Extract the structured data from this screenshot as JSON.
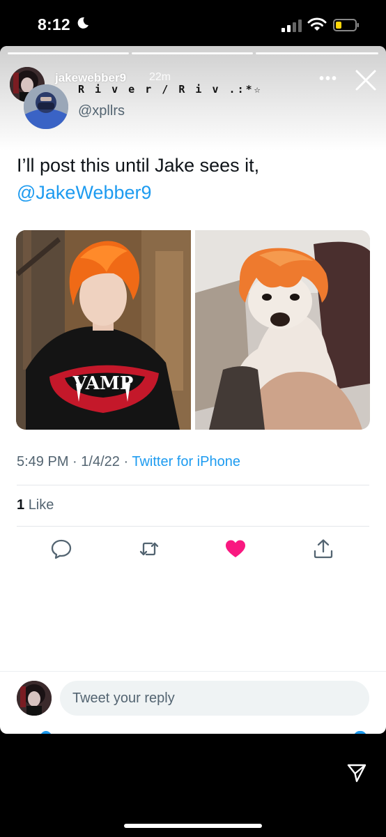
{
  "status_bar": {
    "time": "8:12"
  },
  "story": {
    "username": "jakewebber9",
    "age": "22m",
    "more": "•••",
    "segments": 3
  },
  "tweet": {
    "display_name": "R i v e r / R i v .:*☆",
    "handle": "@xpllrs",
    "text": "I’ll post this until Jake sees it,",
    "mention": "@JakeWebber9",
    "media_images": [
      {
        "description": "orange-haired man in VAMP sweater"
      },
      {
        "description": "chihuahua with orange peel on head"
      }
    ],
    "sweater_text": "VAMP",
    "time": "5:49 PM",
    "date": "1/4/22",
    "separator": "·",
    "source": "Twitter for iPhone",
    "like_count": "1",
    "like_label": "Like"
  },
  "actions": [
    {
      "name": "reply",
      "icon": "speech-bubble-icon"
    },
    {
      "name": "retweet",
      "icon": "retweet-icon"
    },
    {
      "name": "like",
      "icon": "heart-icon",
      "active": true
    },
    {
      "name": "share",
      "icon": "share-icon"
    }
  ],
  "reply_bar": {
    "placeholder": "Tweet your reply"
  },
  "colors": {
    "accent": "#1d9bf0",
    "like": "#f91880",
    "text": "#0f1419",
    "muted": "#536471"
  }
}
